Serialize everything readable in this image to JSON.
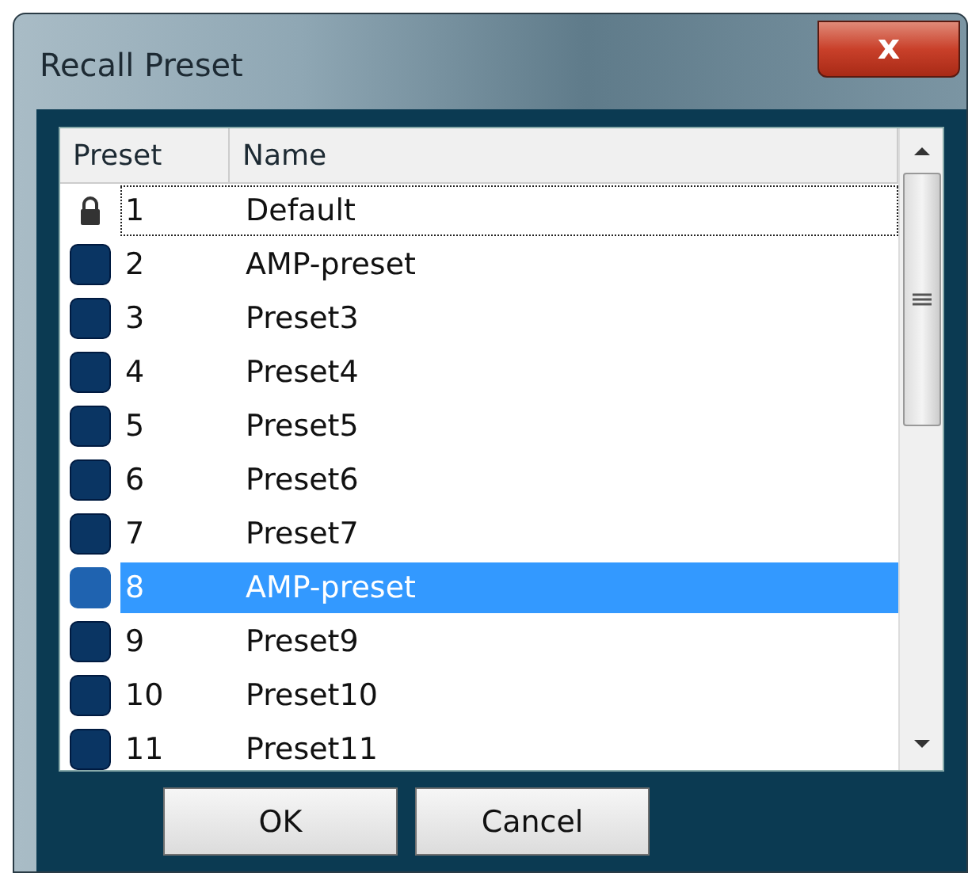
{
  "window": {
    "title": "Recall Preset",
    "close": "x"
  },
  "table": {
    "columns": [
      "Preset",
      "Name"
    ],
    "rows": [
      {
        "kind": "locked",
        "number": "1",
        "name": "Default",
        "selected": false,
        "focused": true
      },
      {
        "kind": "preset",
        "number": "2",
        "name": "AMP-preset",
        "selected": false,
        "focused": false
      },
      {
        "kind": "preset",
        "number": "3",
        "name": "Preset3",
        "selected": false,
        "focused": false
      },
      {
        "kind": "preset",
        "number": "4",
        "name": "Preset4",
        "selected": false,
        "focused": false
      },
      {
        "kind": "preset",
        "number": "5",
        "name": "Preset5",
        "selected": false,
        "focused": false
      },
      {
        "kind": "preset",
        "number": "6",
        "name": "Preset6",
        "selected": false,
        "focused": false
      },
      {
        "kind": "preset",
        "number": "7",
        "name": "Preset7",
        "selected": false,
        "focused": false
      },
      {
        "kind": "preset",
        "number": "8",
        "name": "AMP-preset",
        "selected": true,
        "focused": false
      },
      {
        "kind": "preset",
        "number": "9",
        "name": "Preset9",
        "selected": false,
        "focused": false
      },
      {
        "kind": "preset",
        "number": "10",
        "name": "Preset10",
        "selected": false,
        "focused": false
      },
      {
        "kind": "preset",
        "number": "11",
        "name": "Preset11",
        "selected": false,
        "focused": false
      }
    ]
  },
  "buttons": [
    "OK",
    "Cancel"
  ]
}
